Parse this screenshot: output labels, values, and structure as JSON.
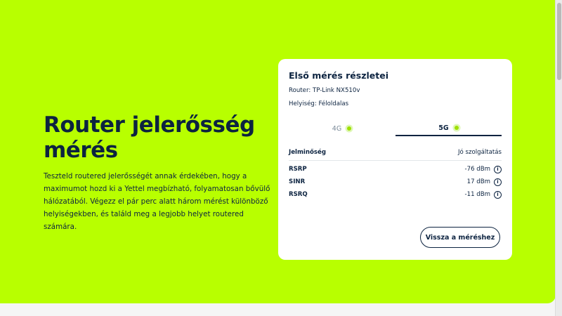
{
  "hero": {
    "title": "Router jelerősség mérés",
    "intro": "Teszteld routered jelerősségét annak érdekében, hogy a maximumot hozd ki a Yettel megbízható, folyamatosan bővülő hálózatából. Végezz el pár perc alatt három mérést különböző helyiségekben, és találd meg a legjobb helyet routered számára."
  },
  "card": {
    "title": "Első mérés részletei",
    "router": "Router: TP-Link NX510v",
    "location": "Helyiség: Féloldalas",
    "tabs": [
      {
        "label": "4G",
        "active": false
      },
      {
        "label": "5G",
        "active": true
      }
    ],
    "signal_quality": {
      "label": "Jelminőség",
      "value": "Jó szolgáltatás"
    },
    "metrics": [
      {
        "label": "RSRP",
        "value": "-76 dBm",
        "icon": "info-icon"
      },
      {
        "label": "SINR",
        "value": "17 dBm",
        "icon": "info-icon"
      },
      {
        "label": "RSRQ",
        "value": "-11 dBm",
        "icon": "info-icon"
      }
    ],
    "back_button": "Vissza a méréshez"
  },
  "colors": {
    "brand_lime": "#b8ff00",
    "navy": "#0c2340",
    "card_bg": "#ffffff",
    "status_dot": "#9fe000"
  }
}
